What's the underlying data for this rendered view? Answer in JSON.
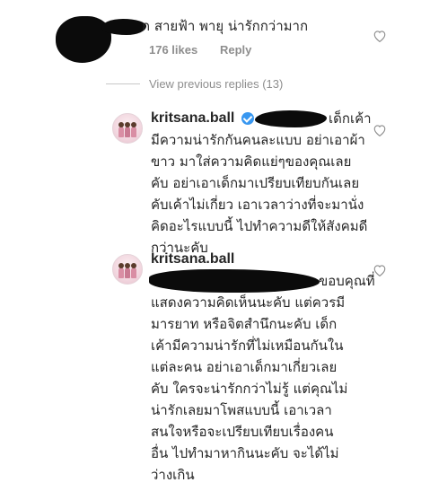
{
  "comment_top": {
    "text": "ก สายฟ้า พายุ น่ารักกว่ามาก",
    "likes": "176 likes",
    "reply": "Reply"
  },
  "view_replies": "View previous replies (13)",
  "reply_1": {
    "username": "kritsana.ball",
    "lines": [
      "เด็กเค้า",
      "มีความน่ารักกันคนละแบบ อย่าเอาผ้า",
      "ขาว มาใส่ความคิดแย่ๆของคุณเลย",
      "คับ  อย่าเอาเด็กมาเปรียบเทียบกันเลย",
      "คับเค้าไม่เกี่ยว เอาเวลาว่างที่จะมานั่ง",
      "คิดอะไรแบบนี้ ไปทำความดีให้สังคมดี",
      "กว่านะคับ"
    ]
  },
  "reply_2": {
    "username": "kritsana.ball",
    "lines": [
      "ขอบคุณที่",
      "แสดงความคิดเห็นนะคับ แต่ควรมี",
      "มารยาท หรือจิตสำนึกนะคับ เด็ก",
      "เค้ามีความน่ารักที่ไม่เหมือนกันใน",
      "แต่ละคน อย่าเอาเด็กมาเกี่ยวเลย",
      "คับ ใครจะน่ารักกว่าไม่รู้ แต่คุณไม่",
      "น่ารักเลยมาโพสแบบนี้ เอาเวลา",
      "สนใจหรือจะเปรียบเทียบเรื่องคน",
      "อื่น ไปทำมาหากินนะคับ จะได้ไม่",
      "ว่างเกิน"
    ]
  },
  "colors": {
    "text": "#262626",
    "meta": "#8e8e8e",
    "verified": "#3897f0",
    "redaction": "#0b0b0b"
  },
  "icons": {
    "like": "heart-outline-icon",
    "verified": "verified-badge-icon"
  }
}
